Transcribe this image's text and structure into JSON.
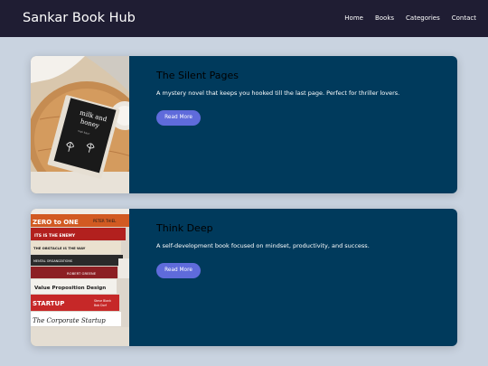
{
  "header": {
    "brand": "Sankar Book Hub",
    "nav": [
      "Home",
      "Books",
      "Categories",
      "Contact"
    ]
  },
  "books": [
    {
      "title": "The Silent Pages",
      "description": "A mystery novel that keeps you hooked till the last page. Perfect for thriller lovers.",
      "button": "Read More",
      "cover_text": [
        "milk and",
        "honey",
        "rupi kaur"
      ]
    },
    {
      "title": "Think Deep",
      "description": "A self-development book focused on mindset, productivity, and success.",
      "button": "Read More",
      "spine_text": [
        "ZERO to ONE",
        "PETER THIEL",
        "ITS IS THE ENEMY",
        "THE OBSTACLE IS THE WAY",
        "MENTAL ORGANIZATIONS",
        "ROBERT GREENE",
        "Value Proposition Design",
        "STARTUP",
        "Steve Blank",
        "Bob Dorf",
        "The Corporate Startup"
      ]
    }
  ],
  "colors": {
    "page_background": "#c9d3e0",
    "navbar": "#1f1d33",
    "card": "#003a5c",
    "button": "#5f6bdb"
  }
}
